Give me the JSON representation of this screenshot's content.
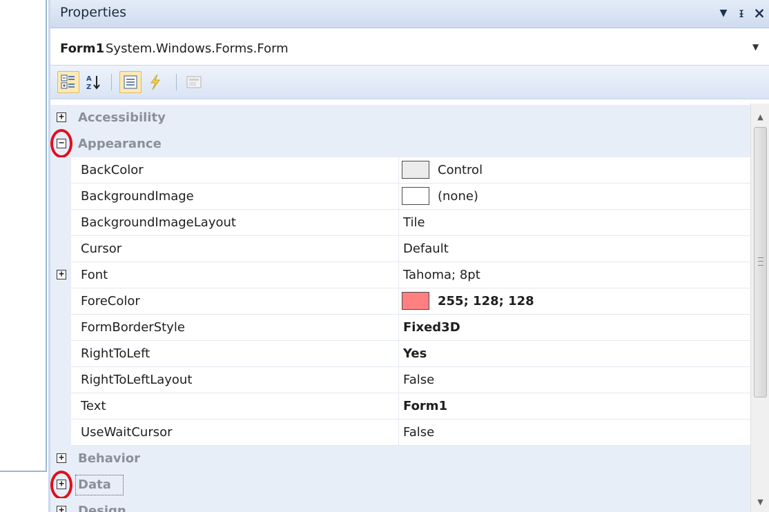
{
  "window": {
    "title": "Properties",
    "buttons": {
      "dropdown_icon": "▼",
      "pin_icon": "ᵻ",
      "close_icon": "×"
    }
  },
  "selector": {
    "object_name": "Form1",
    "object_type": "System.Windows.Forms.Form",
    "dropdown_icon": "▼"
  },
  "toolbar": {
    "buttons": [
      {
        "name": "categorized",
        "active": true
      },
      {
        "name": "alphabetical",
        "active": false
      },
      {
        "name": "properties",
        "active": true
      },
      {
        "name": "events",
        "active": false
      },
      {
        "name": "property-pages",
        "active": false
      }
    ]
  },
  "grid": {
    "rows": [
      {
        "kind": "category",
        "label": "Accessibility",
        "expanded": false
      },
      {
        "kind": "category",
        "label": "Appearance",
        "expanded": true,
        "highlighted": true
      },
      {
        "kind": "prop",
        "name": "BackColor",
        "value": "Control",
        "swatch": "#ececec",
        "bold": false
      },
      {
        "kind": "prop",
        "name": "BackgroundImage",
        "value": "(none)",
        "swatch": "#ffffff",
        "bold": false
      },
      {
        "kind": "prop",
        "name": "BackgroundImageLayout",
        "value": "Tile",
        "bold": false
      },
      {
        "kind": "prop",
        "name": "Cursor",
        "value": "Default",
        "bold": false
      },
      {
        "kind": "prop",
        "name": "Font",
        "value": "Tahoma; 8pt",
        "bold": false,
        "expandable": true
      },
      {
        "kind": "prop",
        "name": "ForeColor",
        "value": "255; 128; 128",
        "swatch": "#ff8080",
        "bold": true
      },
      {
        "kind": "prop",
        "name": "FormBorderStyle",
        "value": "Fixed3D",
        "bold": true
      },
      {
        "kind": "prop",
        "name": "RightToLeft",
        "value": "Yes",
        "bold": true
      },
      {
        "kind": "prop",
        "name": "RightToLeftLayout",
        "value": "False",
        "bold": false
      },
      {
        "kind": "prop",
        "name": "Text",
        "value": "Form1",
        "bold": true
      },
      {
        "kind": "prop",
        "name": "UseWaitCursor",
        "value": "False",
        "bold": false
      },
      {
        "kind": "category",
        "label": "Behavior",
        "expanded": false
      },
      {
        "kind": "category",
        "label": "Data",
        "expanded": false,
        "highlighted": true,
        "focused": true
      },
      {
        "kind": "category",
        "label": "Design",
        "expanded": false
      }
    ]
  },
  "scrollbar": {
    "up_icon": "▲",
    "down_icon": "▼"
  },
  "colors": {
    "highlight_ring": "#e00f1c",
    "category_bg": "#e8eef8",
    "titlebar": "#d6e2f3"
  }
}
